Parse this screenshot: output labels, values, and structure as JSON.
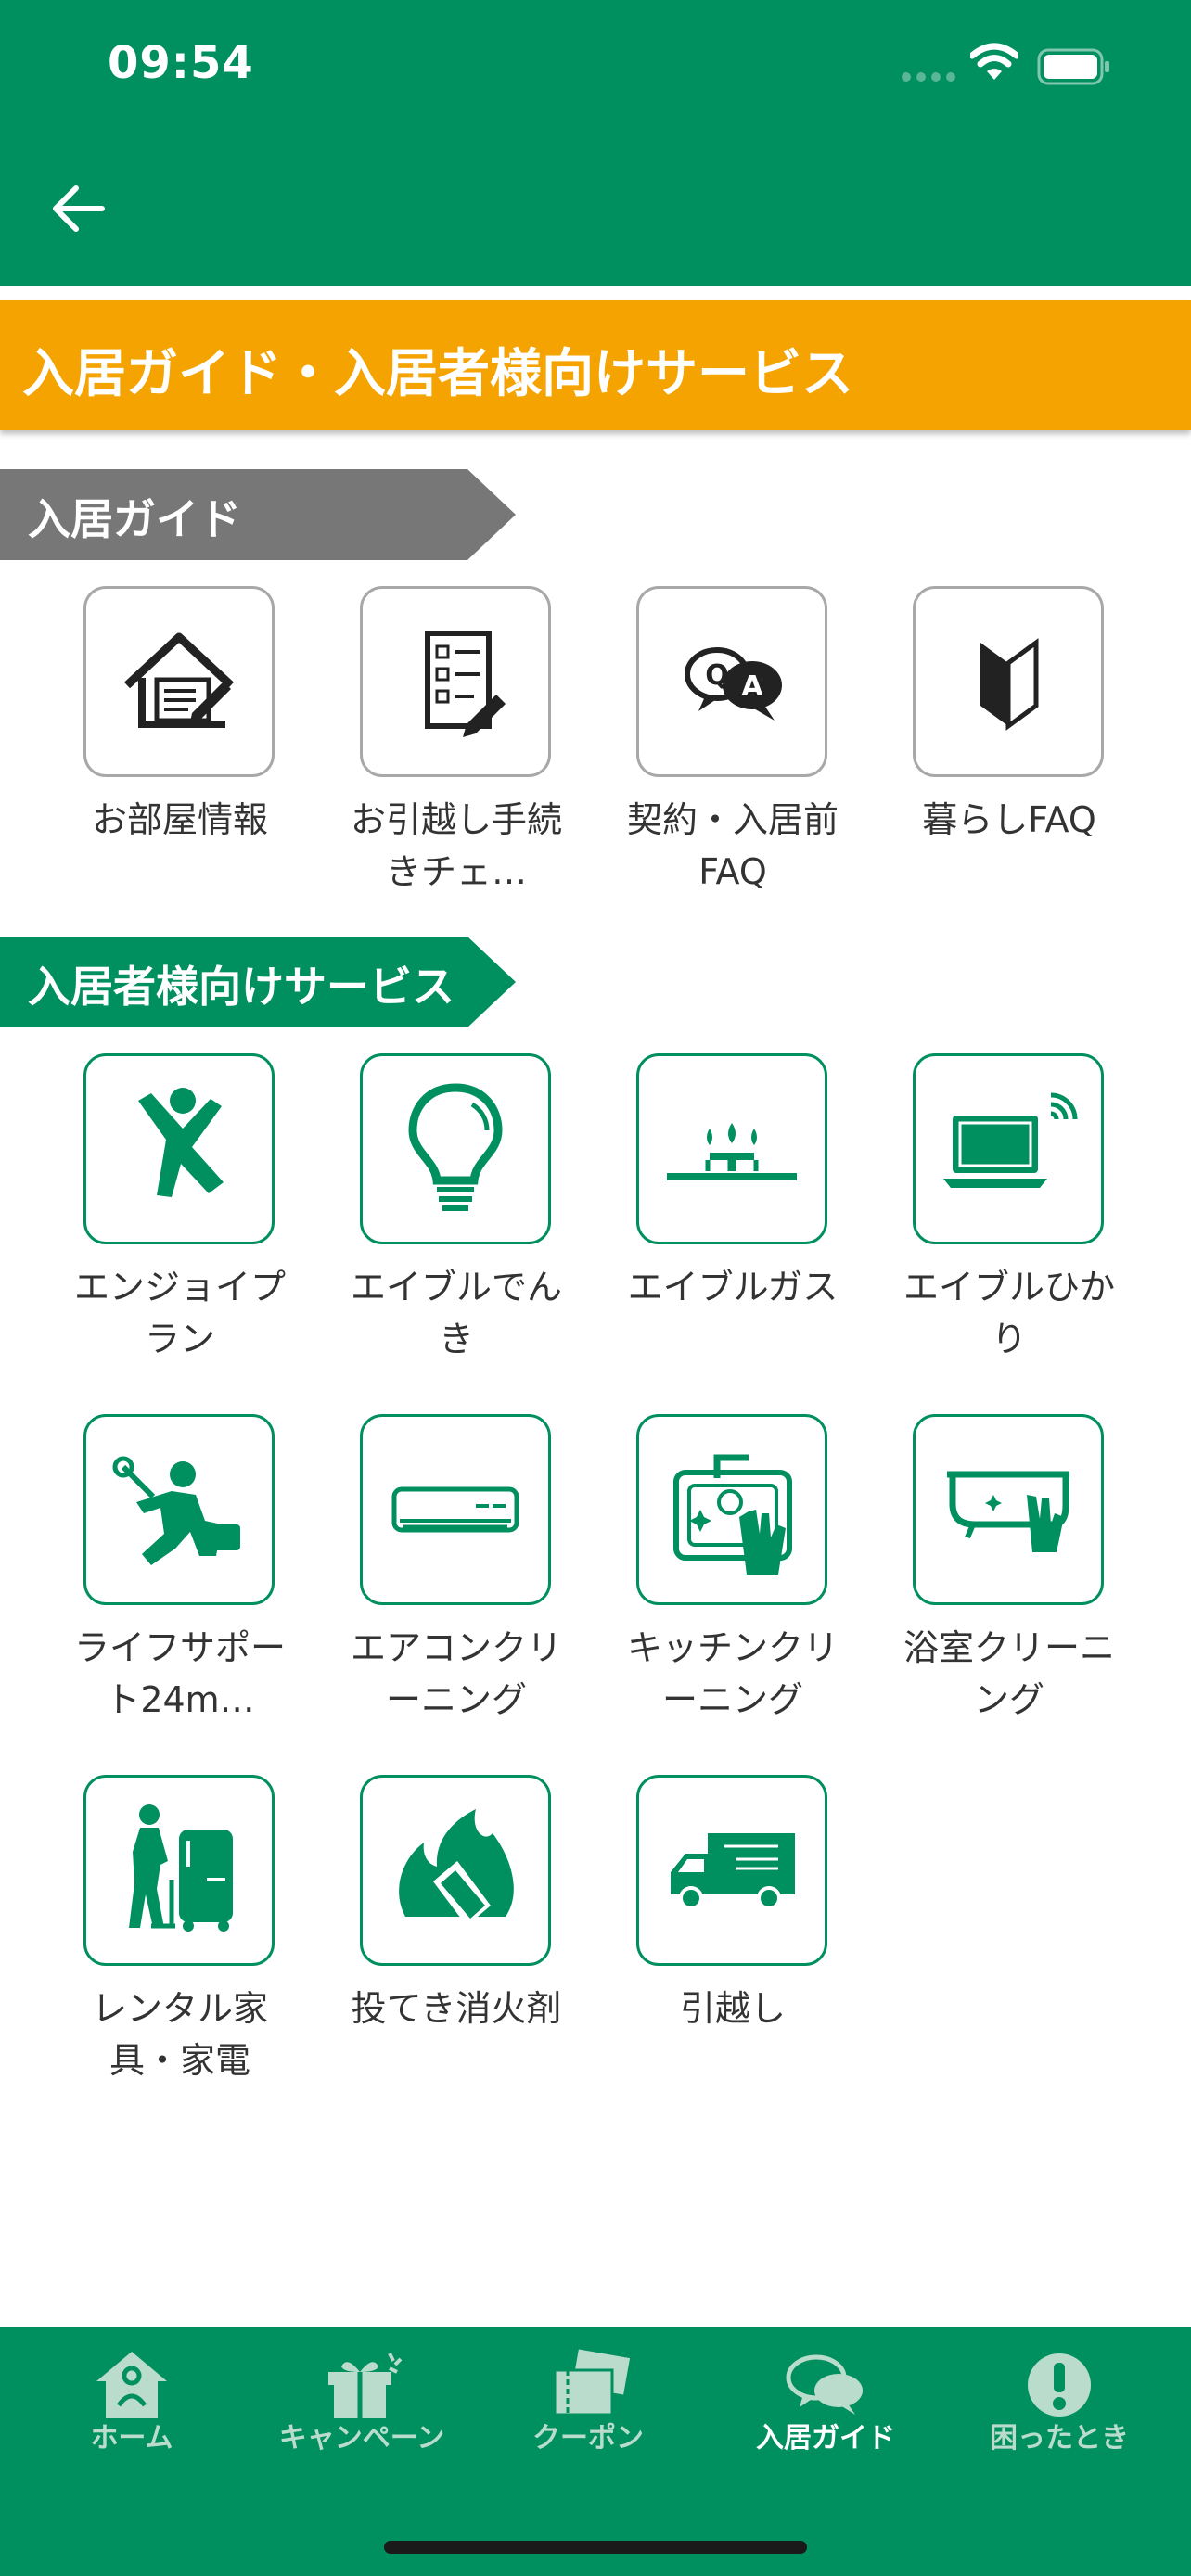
{
  "status_bar": {
    "time": "09:54"
  },
  "header": {
    "back_icon": "arrow-left-icon"
  },
  "page_title": "入居ガイド・入居者様向けサービス",
  "colors": {
    "brand_green": "#008f5e",
    "title_orange": "#f5a300",
    "banner_gray": "#777777"
  },
  "guide_section": {
    "title": "入居ガイド",
    "items": [
      {
        "label": "お部屋情報",
        "icon": "house-document-icon"
      },
      {
        "label": "お引越し手続きチェ…",
        "icon": "checklist-icon"
      },
      {
        "label": "契約・入居前FAQ",
        "icon": "qa-bubbles-icon"
      },
      {
        "label": "暮らしFAQ",
        "icon": "beginner-mark-icon"
      }
    ]
  },
  "services_section": {
    "title": "入居者様向けサービス",
    "items": [
      {
        "label": "エンジョイプラン",
        "icon": "jumping-person-icon"
      },
      {
        "label": "エイブルでんき",
        "icon": "light-bulb-icon"
      },
      {
        "label": "エイブルガス",
        "icon": "gas-stove-icon"
      },
      {
        "label": "エイブルひかり",
        "icon": "laptop-wifi-icon"
      },
      {
        "label": "ライフサポート24m…",
        "icon": "repair-person-icon"
      },
      {
        "label": "エアコンクリーニング",
        "icon": "air-conditioner-icon"
      },
      {
        "label": "キッチンクリーニング",
        "icon": "kitchen-cleaning-icon"
      },
      {
        "label": "浴室クリーニング",
        "icon": "bathtub-cleaning-icon"
      },
      {
        "label": "レンタル家具・家電",
        "icon": "rental-appliance-icon"
      },
      {
        "label": "投てき消火剤",
        "icon": "fire-extinguisher-icon"
      },
      {
        "label": "引越し",
        "icon": "moving-truck-icon"
      }
    ]
  },
  "tab_bar": {
    "active": "入居ガイド",
    "tabs": [
      {
        "label": "ホーム",
        "icon": "home-icon"
      },
      {
        "label": "キャンペーン",
        "icon": "gift-icon"
      },
      {
        "label": "クーポン",
        "icon": "coupon-icon"
      },
      {
        "label": "入居ガイド",
        "icon": "chat-bubbles-icon"
      },
      {
        "label": "困ったとき",
        "icon": "exclamation-icon"
      }
    ]
  }
}
